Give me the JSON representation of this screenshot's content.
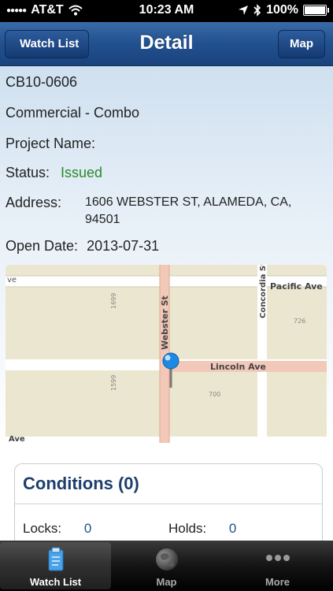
{
  "status_bar": {
    "carrier": "AT&T",
    "time": "10:23 AM",
    "battery": "100%"
  },
  "nav": {
    "title": "Detail",
    "back_label": "Watch List",
    "right_label": "Map"
  },
  "detail": {
    "id": "CB10-0606",
    "type": "Commercial - Combo",
    "project_name_label": "Project Name:",
    "status_label": "Status:",
    "status_value": "Issued",
    "address_label": "Address:",
    "address_value": "1606 WEBSTER ST, ALAMEDA, CA, 94501",
    "open_date_label": "Open Date:",
    "open_date_value": "2013-07-31"
  },
  "map": {
    "streets": [
      "Webster St",
      "Lincoln Ave",
      "Pacific Ave",
      "Concordia St"
    ],
    "partial_labels": [
      "ve",
      "Ave"
    ],
    "parcels": [
      "1699",
      "1599",
      "726",
      "700"
    ],
    "pin_color": "#1e88e5"
  },
  "conditions": {
    "title": "Conditions (0)",
    "locks_label": "Locks:",
    "locks_value": "0",
    "holds_label": "Holds:",
    "holds_value": "0"
  },
  "tabs": [
    {
      "label": "Watch List",
      "icon": "clipboard-icon",
      "active": true
    },
    {
      "label": "Map",
      "icon": "globe-icon",
      "active": false
    },
    {
      "label": "More",
      "icon": "more-dots-icon",
      "active": false
    }
  ],
  "colors": {
    "nav": "#22508f",
    "status_issued": "#2a8a2a",
    "conditions_title": "#1e3e6e"
  }
}
